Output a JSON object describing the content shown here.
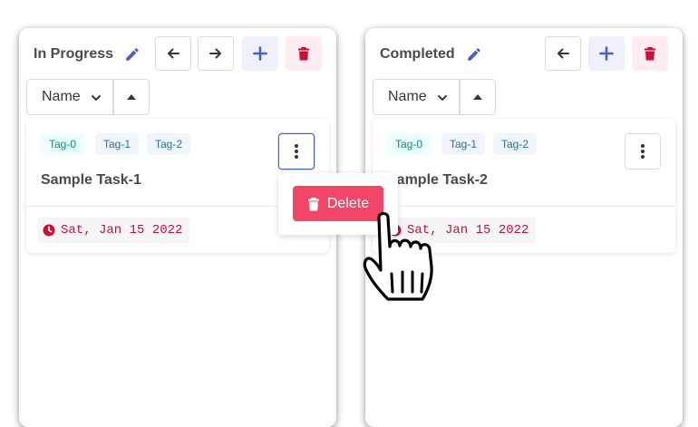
{
  "colors": {
    "primary": "#485fc7",
    "danger": "#f14668",
    "due_date": "#cc0f35",
    "tag_teal_text": "#00947e",
    "tag_blue_text": "#296fa8"
  },
  "columns": [
    {
      "title": "In Progress",
      "icons": [
        "pencil-icon",
        "arrow-left-icon",
        "arrow-right-icon",
        "plus-icon",
        "trash-icon"
      ],
      "sort": {
        "selected": "Name",
        "direction_icon": "caret-up-icon"
      },
      "card": {
        "tags": [
          "Tag-0",
          "Tag-1",
          "Tag-2"
        ],
        "title": "Sample Task-1",
        "due": "Sat, Jan 15 2022",
        "due_icon": "clock-icon",
        "menu": {
          "delete_label": "Delete"
        }
      }
    },
    {
      "title": "Completed",
      "icons": [
        "pencil-icon",
        "arrow-left-icon",
        "plus-icon",
        "trash-icon"
      ],
      "sort": {
        "selected": "Name",
        "direction_icon": "caret-up-icon"
      },
      "card": {
        "tags": [
          "Tag-0",
          "Tag-1",
          "Tag-2"
        ],
        "title": "Sample Task-2",
        "due": "Sat, Jan 15 2022",
        "due_icon": "clock-icon"
      }
    }
  ]
}
